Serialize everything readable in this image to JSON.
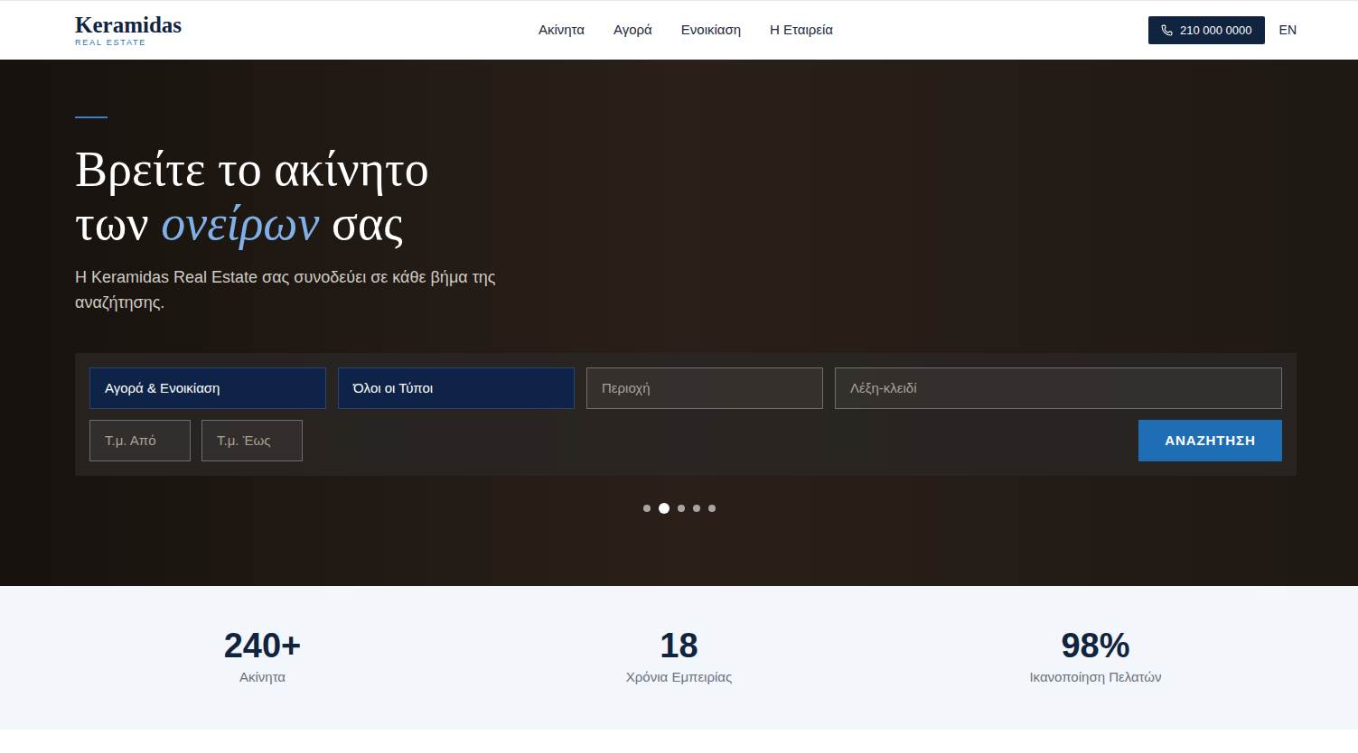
{
  "header": {
    "logo": {
      "name": "Keramidas",
      "tagline": "REAL ESTATE"
    },
    "nav": [
      {
        "label": "Ακίνητα"
      },
      {
        "label": "Αγορά"
      },
      {
        "label": "Ενοικίαση"
      },
      {
        "label": "Η Εταιρεία"
      }
    ],
    "phone": "210 000 0000",
    "language": "EN"
  },
  "hero": {
    "heading": {
      "line1": "Βρείτε το ακίνητο",
      "before": "των",
      "highlight": "ονείρων",
      "after": "σας"
    },
    "subtitle": "Η Keramidas Real Estate σας συνοδεύει σε κάθε βήμα της αναζήτησης.",
    "search": {
      "fields": [
        {
          "kind": "select",
          "text": "Αγορά & Ενοικίαση"
        },
        {
          "kind": "select",
          "text": "Όλοι οι Τύποι"
        },
        {
          "kind": "input",
          "text": "Περιοχή"
        },
        {
          "kind": "input",
          "text": "Λέξη-κλειδί"
        }
      ],
      "area_fields": [
        {
          "kind": "input",
          "text": "Τ.μ. Από"
        },
        {
          "kind": "input",
          "text": "Τ.μ. Έως"
        }
      ],
      "button": "ΑΝΑΖΗΤΗΣΗ"
    },
    "slides": [
      {
        "selected": false
      },
      {
        "selected": true
      },
      {
        "selected": false
      },
      {
        "selected": false
      },
      {
        "selected": false
      }
    ]
  },
  "stats": [
    {
      "value": "240+",
      "label": "Ακίνητα"
    },
    {
      "value": "18",
      "label": "Χρόνια Εμπειρίας"
    },
    {
      "value": "98%",
      "label": "Ικανοποίηση Πελατών"
    }
  ]
}
